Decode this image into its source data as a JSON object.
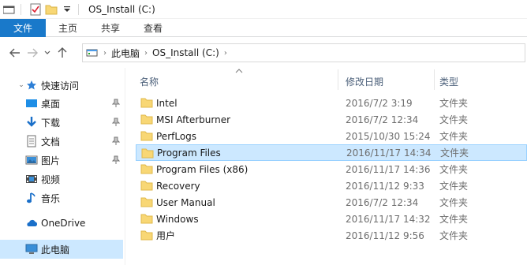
{
  "window": {
    "title": "OS_Install (C:)"
  },
  "ribbon": {
    "tabs": [
      "文件",
      "主页",
      "共享",
      "查看"
    ]
  },
  "address": {
    "crumbs": [
      "此电脑",
      "OS_Install (C:)"
    ]
  },
  "sidebar": {
    "items": [
      {
        "label": "快速访问",
        "icon": "star-icon",
        "pinned": false
      },
      {
        "label": "桌面",
        "icon": "desktop-icon",
        "pinned": true
      },
      {
        "label": "下载",
        "icon": "download-icon",
        "pinned": true
      },
      {
        "label": "文档",
        "icon": "document-icon",
        "pinned": true
      },
      {
        "label": "图片",
        "icon": "pictures-icon",
        "pinned": true
      },
      {
        "label": "视频",
        "icon": "video-icon",
        "pinned": false
      },
      {
        "label": "音乐",
        "icon": "music-icon",
        "pinned": false
      },
      {
        "label": "OneDrive",
        "icon": "cloud-icon",
        "pinned": false
      },
      {
        "label": "此电脑",
        "icon": "computer-icon",
        "pinned": false,
        "selected": true
      }
    ]
  },
  "columns": {
    "name": "名称",
    "modified": "修改日期",
    "type": "类型"
  },
  "files": [
    {
      "name": "Intel",
      "modified": "2016/7/2 3:19",
      "type": "文件夹"
    },
    {
      "name": "MSI Afterburner",
      "modified": "2016/7/2 12:34",
      "type": "文件夹"
    },
    {
      "name": "PerfLogs",
      "modified": "2015/10/30 15:24",
      "type": "文件夹"
    },
    {
      "name": "Program Files",
      "modified": "2016/11/17 14:34",
      "type": "文件夹",
      "selected": true
    },
    {
      "name": "Program Files (x86)",
      "modified": "2016/11/17 14:36",
      "type": "文件夹"
    },
    {
      "name": "Recovery",
      "modified": "2016/11/12 9:33",
      "type": "文件夹"
    },
    {
      "name": "User Manual",
      "modified": "2016/7/2 12:34",
      "type": "文件夹"
    },
    {
      "name": "Windows",
      "modified": "2016/11/17 14:32",
      "type": "文件夹"
    },
    {
      "name": "用户",
      "modified": "2016/11/12 9:56",
      "type": "文件夹"
    }
  ],
  "colors": {
    "accent": "#1979ca",
    "selection": "#cce8ff",
    "folder": "#f8d775"
  }
}
